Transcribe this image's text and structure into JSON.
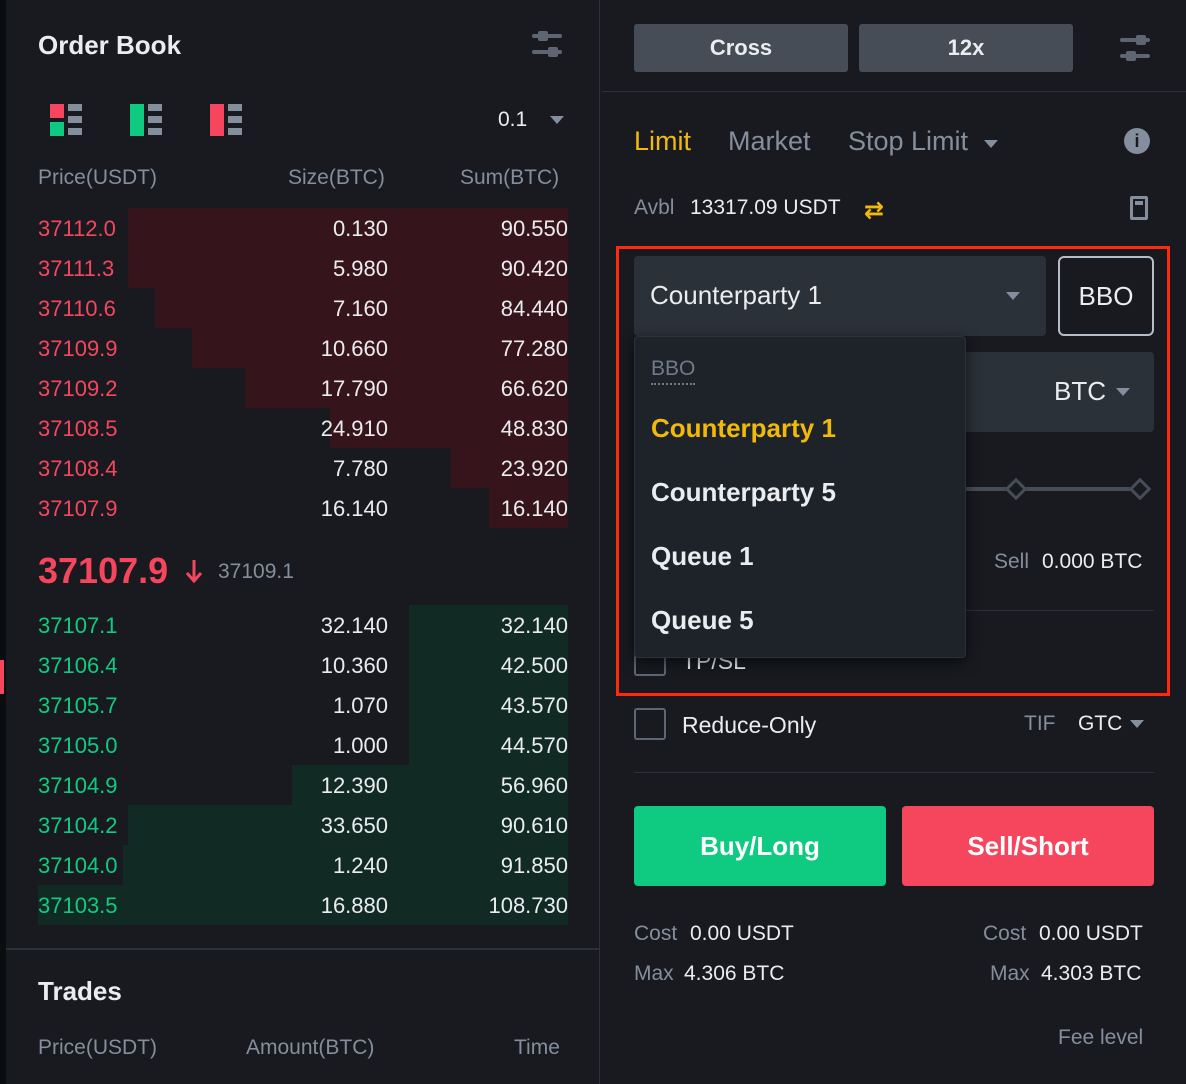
{
  "order_book": {
    "title": "Order Book",
    "depth": "0.1",
    "headers": {
      "price": "Price(USDT)",
      "size": "Size(BTC)",
      "sum": "Sum(BTC)"
    },
    "asks": [
      {
        "price": "37112.0",
        "size": "0.130",
        "sum": "90.550",
        "depth_fraction": 0.83
      },
      {
        "price": "37111.3",
        "size": "5.980",
        "sum": "90.420",
        "depth_fraction": 0.83
      },
      {
        "price": "37110.6",
        "size": "7.160",
        "sum": "84.440",
        "depth_fraction": 0.78
      },
      {
        "price": "37109.9",
        "size": "10.660",
        "sum": "77.280",
        "depth_fraction": 0.71
      },
      {
        "price": "37109.2",
        "size": "17.790",
        "sum": "66.620",
        "depth_fraction": 0.61
      },
      {
        "price": "37108.5",
        "size": "24.910",
        "sum": "48.830",
        "depth_fraction": 0.45
      },
      {
        "price": "37108.4",
        "size": "7.780",
        "sum": "23.920",
        "depth_fraction": 0.22
      },
      {
        "price": "37107.9",
        "size": "16.140",
        "sum": "16.140",
        "depth_fraction": 0.15
      }
    ],
    "last_price": "37107.9",
    "mark_price": "37109.1",
    "bids": [
      {
        "price": "37107.1",
        "size": "32.140",
        "sum": "32.140",
        "depth_fraction": 0.3
      },
      {
        "price": "37106.4",
        "size": "10.360",
        "sum": "42.500",
        "depth_fraction": 0.3
      },
      {
        "price": "37105.7",
        "size": "1.070",
        "sum": "43.570",
        "depth_fraction": 0.3
      },
      {
        "price": "37105.0",
        "size": "1.000",
        "sum": "44.570",
        "depth_fraction": 0.3
      },
      {
        "price": "37104.9",
        "size": "12.390",
        "sum": "56.960",
        "depth_fraction": 0.52
      },
      {
        "price": "37104.2",
        "size": "33.650",
        "sum": "90.610",
        "depth_fraction": 0.83
      },
      {
        "price": "37104.0",
        "size": "1.240",
        "sum": "91.850",
        "depth_fraction": 0.84
      },
      {
        "price": "37103.5",
        "size": "16.880",
        "sum": "108.730",
        "depth_fraction": 1.0
      }
    ],
    "colors": {
      "ask": "#f6465d",
      "bid": "#0ecb81"
    }
  },
  "trades": {
    "title": "Trades",
    "headers": {
      "price": "Price(USDT)",
      "amount": "Amount(BTC)",
      "time": "Time"
    }
  },
  "order_form": {
    "margin_mode": "Cross",
    "leverage": "12x",
    "tabs": [
      "Limit",
      "Market",
      "Stop Limit"
    ],
    "avbl_label": "Avbl",
    "avbl_value": "13317.09 USDT",
    "price_type_selected": "Counterparty 1",
    "bbo_label": "BBO",
    "size_unit": "BTC",
    "sell_label": "Sell",
    "sell_value": "0.000 BTC",
    "tpsl_label": "TP/SL",
    "reduce_only_label": "Reduce-Only",
    "tif_label": "TIF",
    "tif_value": "GTC",
    "buy_label": "Buy/Long",
    "sell_short_label": "Sell/Short",
    "buy_cost_label": "Cost",
    "buy_cost_value": "0.00 USDT",
    "buy_max_label": "Max",
    "buy_max_value": "4.306 BTC",
    "sell_cost_label": "Cost",
    "sell_cost_value": "0.00 USDT",
    "sell_max_label": "Max",
    "sell_max_value": "4.303 BTC",
    "fee_level": "Fee level",
    "accent": "#f0b90b"
  },
  "dropdown": {
    "header": "BBO",
    "items": [
      "Counterparty 1",
      "Counterparty 5",
      "Queue 1",
      "Queue 5"
    ],
    "selected": "Counterparty 1"
  }
}
